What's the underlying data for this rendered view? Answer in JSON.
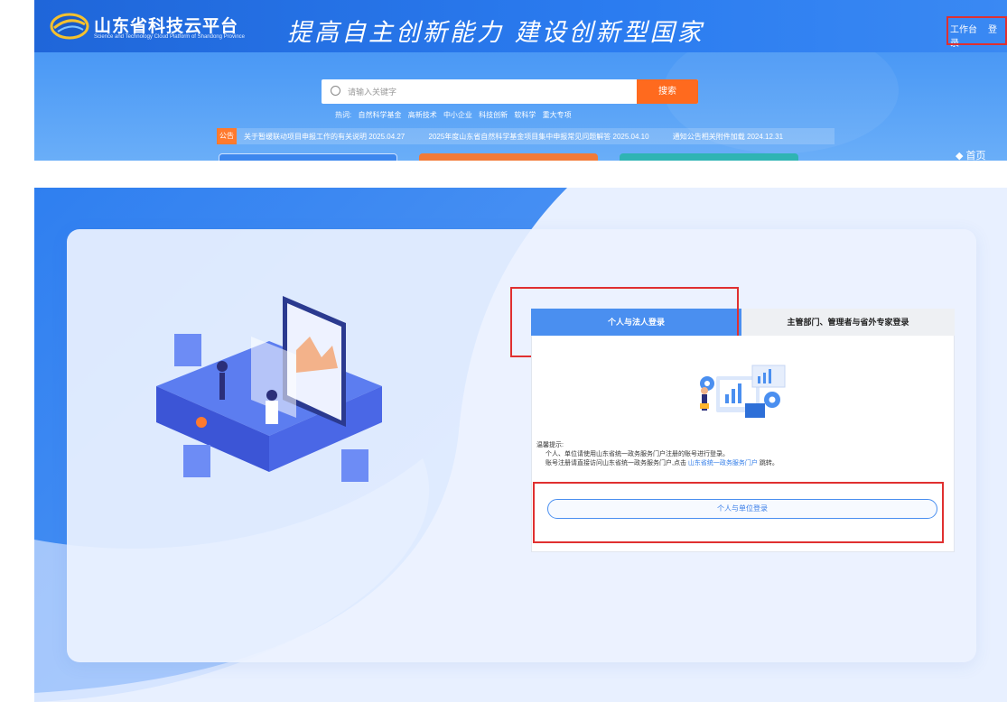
{
  "banner": {
    "logo_cn": "山东省科技云平台",
    "logo_en": "Science and Technology Cloud Platform of Shandong Province",
    "slogan": "提高自主创新能力 建设创新型国家",
    "links": {
      "workbench": "工作台",
      "login": "登录"
    },
    "search": {
      "placeholder": "请输入关键字",
      "button": "搜索"
    },
    "hot": {
      "label": "热词:",
      "items": [
        "自然科学基金",
        "高新技术",
        "中小企业",
        "科技创新",
        "软科学",
        "重大专项"
      ]
    },
    "notice": {
      "tag": "公告",
      "items": [
        "关于暂缓联动项目申报工作的有关说明  2025.04.27",
        "2025年度山东省自然科学基金项目集中申报常见问题解答  2025.04.10",
        "通知公告相关附件加载  2024.12.31"
      ]
    },
    "home_link": "首页"
  },
  "login": {
    "tabs": {
      "personal": "个人与法人登录",
      "admin": "主管部门、管理者与省外专家登录"
    },
    "tip": {
      "title": "温馨提示:",
      "line1": "个人、单位请使用山东省统一政务服务门户注册的账号进行登录。",
      "line2_pre": "账号注册请直接访问山东省统一政务服务门户,点击",
      "line2_link": "山东省统一政务服务门户",
      "line2_post": "跳转。"
    },
    "login_button": "个人与单位登录"
  },
  "colors": {
    "header_blue": "#2b7cf0",
    "tab_blue": "#4a8ff0",
    "search_orange": "#ff6a1e",
    "highlight_red": "#e03030"
  }
}
